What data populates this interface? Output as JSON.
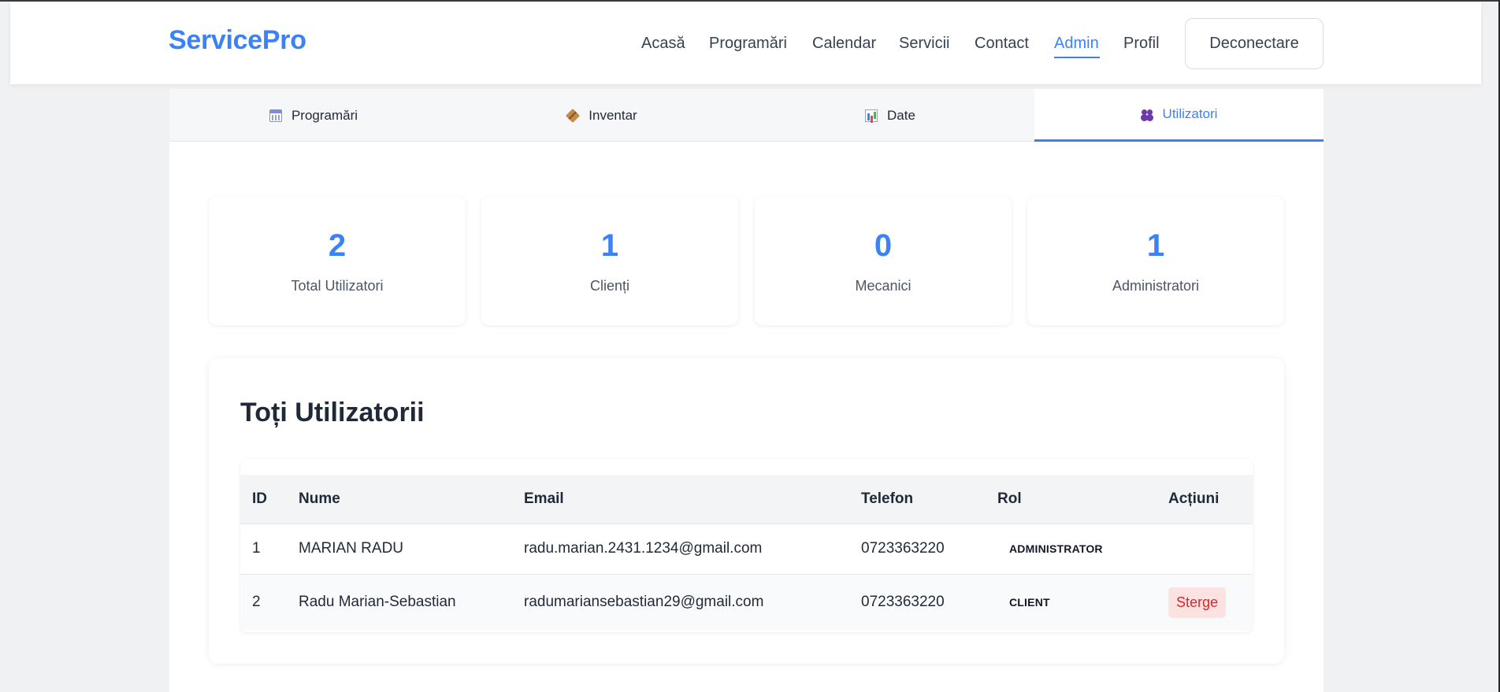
{
  "header": {
    "logo": "ServicePro",
    "nav": [
      "Acasă",
      "Programări",
      "Calendar",
      "Servicii",
      "Contact",
      "Admin",
      "Profil"
    ],
    "active_nav": "Admin",
    "logout_label": "Deconectare"
  },
  "tabs": [
    {
      "label": "Programări",
      "icon": "calendar-icon"
    },
    {
      "label": "Inventar",
      "icon": "package-icon"
    },
    {
      "label": "Date",
      "icon": "bar-chart-icon"
    },
    {
      "label": "Utilizatori",
      "icon": "users-icon"
    }
  ],
  "active_tab": "Utilizatori",
  "stats": [
    {
      "value": "2",
      "label": "Total Utilizatori"
    },
    {
      "value": "1",
      "label": "Clienți"
    },
    {
      "value": "0",
      "label": "Mecanici"
    },
    {
      "value": "1",
      "label": "Administratori"
    }
  ],
  "users": {
    "title": "Toți Utilizatorii",
    "columns": [
      "ID",
      "Nume",
      "Email",
      "Telefon",
      "Rol",
      "Acțiuni"
    ],
    "rows": [
      {
        "id": "1",
        "name": "MARIAN RADU",
        "email": "radu.marian.2431.1234@gmail.com",
        "phone": "0723363220",
        "role": "ADMINISTRATOR",
        "action": ""
      },
      {
        "id": "2",
        "name": "Radu Marian-Sebastian",
        "email": "radumariansebastian29@gmail.com",
        "phone": "0723363220",
        "role": "CLIENT",
        "action": "Sterge"
      }
    ]
  },
  "colors": {
    "accent": "#3b82f6",
    "danger": "#dc2626",
    "danger_bg": "#fde2e2"
  }
}
